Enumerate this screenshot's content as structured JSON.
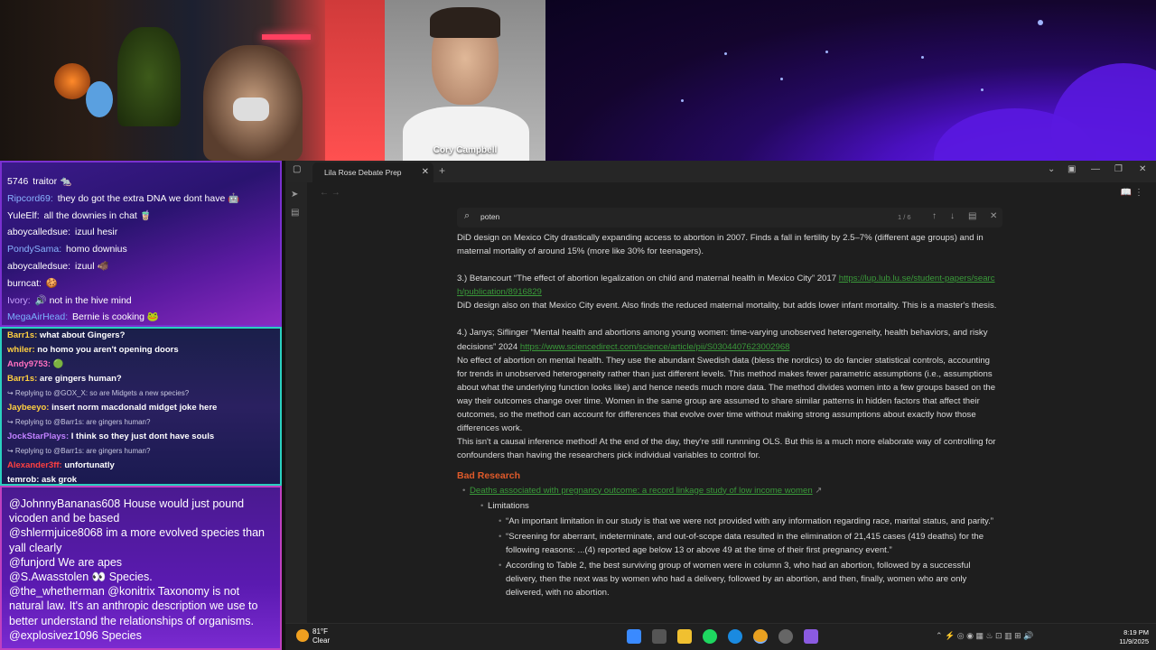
{
  "webcam": {
    "guest_name": "Cory Campbell"
  },
  "chat_top": [
    {
      "user": "5746",
      "msg": "traitor 🐀",
      "color": "#ffffff"
    },
    {
      "user": "Ripcord69:",
      "msg": "they do got the extra DNA we dont have 🤖",
      "color": "#8ab4ff"
    },
    {
      "user": "YuleElf:",
      "msg": "all the downies in chat 🧋",
      "color": "#ffffff"
    },
    {
      "user": "aboycalledsue:",
      "msg": "izuul hesir",
      "color": "#ffffff"
    },
    {
      "user": "PondySama:",
      "msg": "homo downius",
      "color": "#8ab4ff"
    },
    {
      "user": "aboycalledsue:",
      "msg": "izuul 🐗",
      "color": "#ffffff"
    },
    {
      "user": "burncat:",
      "msg": "🍪",
      "color": "#ffffff"
    },
    {
      "user": "Ivory:",
      "msg": "🔊 not in the hive mind",
      "color": "#c8a0ff"
    },
    {
      "user": "MegaAirHead:",
      "msg": "Bernie is cooking 🐸",
      "color": "#7ab0ff"
    }
  ],
  "chat_mid": [
    {
      "type": "msg",
      "user": "Barr1s:",
      "msg": "what about Gingers?",
      "color": "#ffd040"
    },
    {
      "type": "msg",
      "user": "whiler:",
      "msg": "no homo you aren't opening doors",
      "color": "#ffd040"
    },
    {
      "type": "msg",
      "user": "Andy9753:",
      "msg": "🟢",
      "color": "#ff70c0"
    },
    {
      "type": "msg",
      "user": "Barr1s:",
      "msg": "are gingers human?",
      "color": "#ffd040"
    },
    {
      "type": "reply",
      "text": "↪ Replying to @GOX_X: so are Midgets a new species?"
    },
    {
      "type": "msg",
      "user": "Jaybeeyo:",
      "msg": "insert norm macdonald midget joke here",
      "color": "#ffd040"
    },
    {
      "type": "reply",
      "text": "↪ Replying to @Barr1s: are gingers human?"
    },
    {
      "type": "msg",
      "user": "JockStarPlays:",
      "msg": "I think so they just dont have souls",
      "color": "#c080ff"
    },
    {
      "type": "reply",
      "text": "↪ Replying to @Barr1s: are gingers human?"
    },
    {
      "type": "msg",
      "user": "Alexander3ff:",
      "msg": "unfortunatly",
      "color": "#ff4040"
    },
    {
      "type": "msg",
      "user": "temrob:",
      "msg": "ask grok",
      "color": "#ffffff"
    }
  ],
  "chat_bottom": [
    {
      "user": "@JohnnyBananas608",
      "msg": "House would just pound vicoden and be based"
    },
    {
      "user": "@shlermjuice8068",
      "msg": "im a more evolved species than yall clearly"
    },
    {
      "user": "@funjord",
      "msg": "We are apes"
    },
    {
      "user": "@S.Awasstolen",
      "msg": "👀 Species."
    },
    {
      "user": "@the_whetherman",
      "msg": "@konitrix Taxonomy is not natural law. It's an anthropic description we use to better understand the relationships of organisms."
    },
    {
      "user": "@explosivez1096",
      "msg": "Species"
    }
  ],
  "app": {
    "tab_title": "Lila Rose Debate Prep",
    "search": {
      "query": "poten",
      "count": "1 / 6"
    }
  },
  "doc": {
    "p1": "DiD design on Mexico City drastically expanding access to abortion in 2007. Finds a fall in fertility by 2.5–7% (different age groups) and in maternal mortality of around 15% (more like 30% for teenagers).",
    "p2_text": "3.) Betancourt “The effect of abortion legalization on child and maternal health in Mexico City” 2017 ",
    "p2_link": "https://lup.lub.lu.se/student-papers/search/publication/8916829",
    "p3": "DiD design also on that Mexico City event. Also finds the reduced maternal mortality, but adds lower infant mortality. This is a master's thesis.",
    "p4_text": "4.) Janys; Siflinger “Mental health and abortions among young women: time-varying unobserved heterogeneity, health behaviors, and risky decisions” 2024 ",
    "p4_link": "https://www.sciencedirect.com/science/article/pii/S0304407623002968",
    "p5": "No effect of abortion on mental health. They use the abundant Swedish data (bless the nordics) to do fancier statistical controls, accounting for trends in unobserved heterogeneity rather than just different levels. This method makes fewer parametric assumptions (i.e., assumptions about what the underlying function looks like) and hence needs much more data. The method divides women into a few groups based on the way their outcomes change over time. Women in the same group are assumed to share similar patterns in hidden factors that affect their outcomes, so the method can account for differences that evolve over time without making strong assumptions about exactly how those differences work.",
    "p6": "This isn't a causal inference method! At the end of the day, they're still runnning OLS. But this is a much more elaborate way of controlling for confounders than having the researchers pick individual variables to control for.",
    "heading": "Bad Research",
    "bullet_link": "Deaths associated with pregnancy outcome: a record linkage study of low income women",
    "sub_bullet": "Limitations",
    "items": [
      "“An important limitation in our study is that we were not provided with any information regarding race, marital status, and parity.”",
      "“Screening for aberrant, indeterminate, and out-of-scope data resulted in the elimination of 21,415 cases (419 deaths) for the following reasons: ...(4) reported age below 13 or above 49 at the time of their first pregnancy event.”",
      "According to Table 2, the best surviving group of women were in column 3, who had an abortion, followed by a successful delivery, then the next was by women who had a delivery, followed by an abortion, and then, finally, women who are only delivered, with no abortion."
    ]
  },
  "taskbar": {
    "temp": "81°F",
    "condition": "Clear",
    "time": "8:19 PM",
    "date": "11/9/2025"
  },
  "colors": {
    "link": "#3a9a3a",
    "heading": "#e05a2a",
    "accent_purple": "#6a20ff"
  }
}
